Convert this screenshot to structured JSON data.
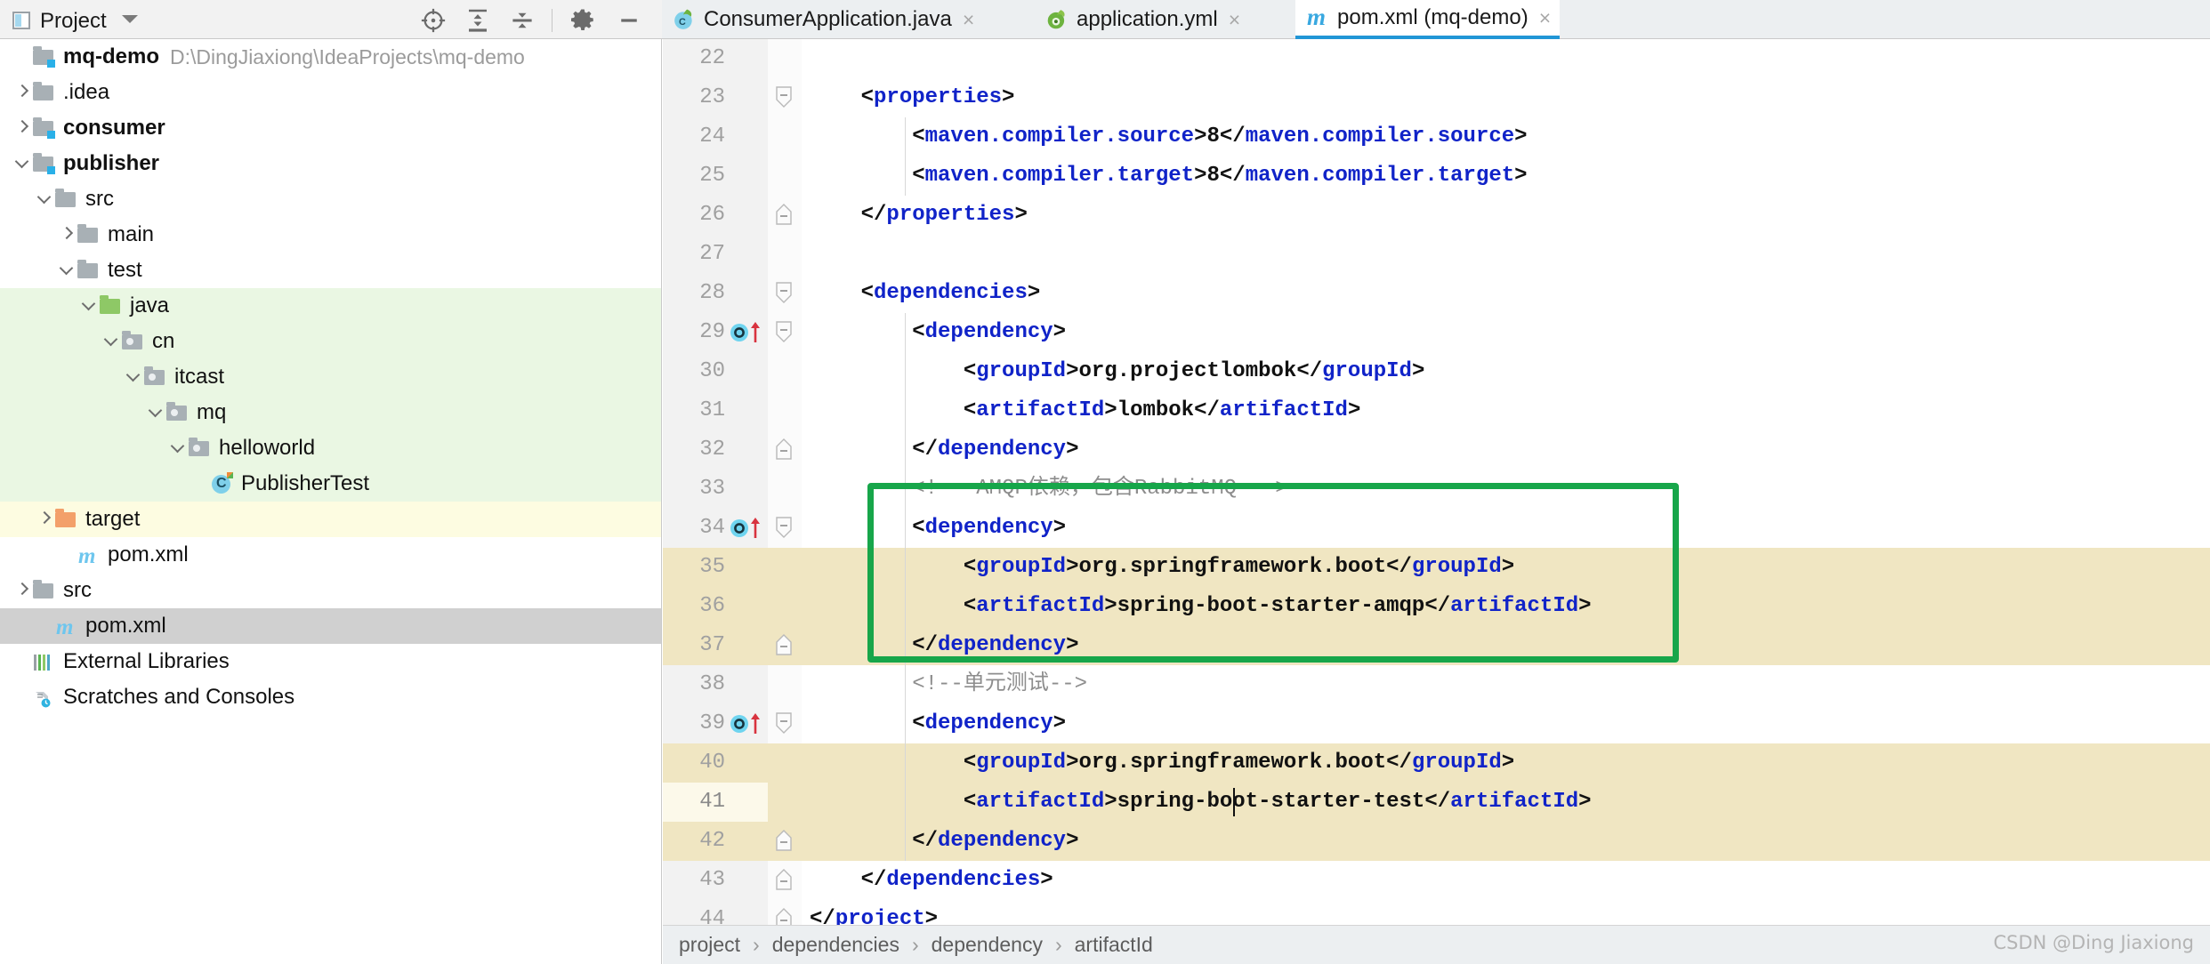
{
  "panel": {
    "title": "Project",
    "icon": "project-panel-icon",
    "caret": "chevron-down-icon",
    "toolbar": [
      {
        "name": "locate-target-icon",
        "tip": "Select Opened File"
      },
      {
        "name": "expand-all-icon",
        "tip": "Expand All"
      },
      {
        "name": "collapse-all-icon",
        "tip": "Collapse All"
      },
      {
        "name": "gear-icon",
        "tip": "Settings"
      },
      {
        "name": "minimize-icon",
        "tip": "Hide"
      }
    ]
  },
  "tabs": [
    {
      "label": "ConsumerApplication.java",
      "icon": "spring-boot-class-icon",
      "active": false,
      "close": "×"
    },
    {
      "label": "application.yml",
      "icon": "spring-yaml-icon",
      "active": false,
      "close": "×"
    },
    {
      "label": "pom.xml (mq-demo)",
      "icon": "maven-icon",
      "active": true,
      "close": "×"
    }
  ],
  "tree": [
    {
      "label": "mq-demo",
      "path": "D:\\DingJiaxiong\\IdeaProjects\\mq-demo",
      "icon": "module-folder-icon",
      "indent": 0,
      "arrow": "",
      "bold": true,
      "highlight": ""
    },
    {
      "label": ".idea",
      "icon": "folder-icon",
      "indent": 0,
      "arrow": "right",
      "bold": false,
      "highlight": ""
    },
    {
      "label": "consumer",
      "icon": "module-folder-icon",
      "indent": 0,
      "arrow": "right",
      "bold": true,
      "highlight": ""
    },
    {
      "label": "publisher",
      "icon": "module-folder-icon",
      "indent": 0,
      "arrow": "down",
      "bold": true,
      "highlight": ""
    },
    {
      "label": "src",
      "icon": "folder-icon",
      "indent": 1,
      "arrow": "down",
      "bold": false,
      "highlight": ""
    },
    {
      "label": "main",
      "icon": "folder-icon",
      "indent": 2,
      "arrow": "right",
      "bold": false,
      "highlight": ""
    },
    {
      "label": "test",
      "icon": "folder-icon",
      "indent": 2,
      "arrow": "down",
      "bold": false,
      "highlight": ""
    },
    {
      "label": "java",
      "icon": "test-source-folder-icon",
      "indent": 3,
      "arrow": "down",
      "bold": false,
      "highlight": "green"
    },
    {
      "label": "cn",
      "icon": "package-icon",
      "indent": 4,
      "arrow": "down",
      "bold": false,
      "highlight": "green"
    },
    {
      "label": "itcast",
      "icon": "package-icon",
      "indent": 5,
      "arrow": "down",
      "bold": false,
      "highlight": "green"
    },
    {
      "label": "mq",
      "icon": "package-icon",
      "indent": 6,
      "arrow": "down",
      "bold": false,
      "highlight": "green"
    },
    {
      "label": "helloworld",
      "icon": "package-icon",
      "indent": 7,
      "arrow": "down",
      "bold": false,
      "highlight": "green"
    },
    {
      "label": "PublisherTest",
      "icon": "test-class-icon",
      "indent": 8,
      "arrow": "",
      "bold": false,
      "highlight": "green"
    },
    {
      "label": "target",
      "icon": "excluded-folder-icon",
      "indent": 1,
      "arrow": "right",
      "bold": false,
      "highlight": "yellow"
    },
    {
      "label": "pom.xml",
      "icon": "maven-icon",
      "indent": 2,
      "arrow": "",
      "bold": false,
      "highlight": ""
    },
    {
      "label": "src",
      "icon": "folder-icon",
      "indent": 0,
      "arrow": "right",
      "bold": false,
      "highlight": ""
    },
    {
      "label": "pom.xml",
      "icon": "maven-icon",
      "indent": 1,
      "arrow": "",
      "bold": false,
      "highlight": "sel"
    },
    {
      "label": "External Libraries",
      "icon": "external-libraries-icon",
      "indent": 0,
      "arrow": "",
      "bold": false,
      "highlight": ""
    },
    {
      "label": "Scratches and Consoles",
      "icon": "scratches-icon",
      "indent": 0,
      "arrow": "",
      "bold": false,
      "highlight": ""
    }
  ],
  "editor": {
    "first_line": 22,
    "current_line": 41,
    "lines": [
      {
        "n": 22,
        "text": "",
        "fold": "",
        "gutter_icon": false,
        "indent_guide": false
      },
      {
        "n": 23,
        "text": "    <properties>",
        "fold": "start",
        "gutter_icon": false,
        "indent_guide": false
      },
      {
        "n": 24,
        "text": "        <maven.compiler.source>8</maven.compiler.source>",
        "fold": "",
        "gutter_icon": false,
        "indent_guide": true
      },
      {
        "n": 25,
        "text": "        <maven.compiler.target>8</maven.compiler.target>",
        "fold": "",
        "gutter_icon": false,
        "indent_guide": true
      },
      {
        "n": 26,
        "text": "    </properties>",
        "fold": "end",
        "gutter_icon": false,
        "indent_guide": false
      },
      {
        "n": 27,
        "text": "",
        "fold": "",
        "gutter_icon": false,
        "indent_guide": false
      },
      {
        "n": 28,
        "text": "    <dependencies>",
        "fold": "start",
        "gutter_icon": false,
        "indent_guide": false
      },
      {
        "n": 29,
        "text": "        <dependency>",
        "fold": "start",
        "gutter_icon": true,
        "indent_guide": true
      },
      {
        "n": 30,
        "text": "            <groupId>org.projectlombok</groupId>",
        "fold": "",
        "gutter_icon": false,
        "indent_guide": true
      },
      {
        "n": 31,
        "text": "            <artifactId>lombok</artifactId>",
        "fold": "",
        "gutter_icon": false,
        "indent_guide": true
      },
      {
        "n": 32,
        "text": "        </dependency>",
        "fold": "end",
        "gutter_icon": false,
        "indent_guide": true
      },
      {
        "n": 33,
        "text": "        <!-- AMQP依赖，包含RabbitMQ -->",
        "fold": "",
        "gutter_icon": false,
        "indent_guide": true
      },
      {
        "n": 34,
        "text": "        <dependency>",
        "fold": "start",
        "gutter_icon": true,
        "indent_guide": true
      },
      {
        "n": 35,
        "text": "            <groupId>org.springframework.boot</groupId>",
        "fold": "",
        "gutter_icon": false,
        "indent_guide": true
      },
      {
        "n": 36,
        "text": "            <artifactId>spring-boot-starter-amqp</artifactId>",
        "fold": "",
        "gutter_icon": false,
        "indent_guide": true
      },
      {
        "n": 37,
        "text": "        </dependency>",
        "fold": "end",
        "gutter_icon": false,
        "indent_guide": true
      },
      {
        "n": 38,
        "text": "        <!--单元测试-->",
        "fold": "",
        "gutter_icon": false,
        "indent_guide": true
      },
      {
        "n": 39,
        "text": "        <dependency>",
        "fold": "start",
        "gutter_icon": true,
        "indent_guide": true
      },
      {
        "n": 40,
        "text": "            <groupId>org.springframework.boot</groupId>",
        "fold": "",
        "gutter_icon": false,
        "indent_guide": true
      },
      {
        "n": 41,
        "text": "            <artifactId>spring-boot-starter-test</artifactId>",
        "fold": "",
        "gutter_icon": false,
        "indent_guide": true
      },
      {
        "n": 42,
        "text": "        </dependency>",
        "fold": "end",
        "gutter_icon": false,
        "indent_guide": true
      },
      {
        "n": 43,
        "text": "    </dependencies>",
        "fold": "end",
        "gutter_icon": false,
        "indent_guide": false
      },
      {
        "n": 44,
        "text": "</project>",
        "fold": "end",
        "gutter_icon": false,
        "indent_guide": false
      }
    ],
    "highlighted_lines": [
      35,
      36,
      37,
      40,
      41,
      42
    ],
    "annotation": {
      "name": "green-highlight-box",
      "color": "#17a64a",
      "from_line": 33,
      "to_line": 37
    }
  },
  "breadcrumb": [
    "project",
    "dependencies",
    "dependency",
    "artifactId"
  ],
  "breadcrumb_separator": "›",
  "watermark": "CSDN @Ding Jiaxiong",
  "colors": {
    "accent": "#2196d6",
    "xml_tag": "#1023c8",
    "comment": "#8d8d8d",
    "annotation_green": "#17a64a",
    "highlight_beige": "#f0e6c2",
    "test_root_green": "#eaf7e3",
    "excluded_yellow": "#fdfce1",
    "selection_grey": "#d0d0d0"
  }
}
